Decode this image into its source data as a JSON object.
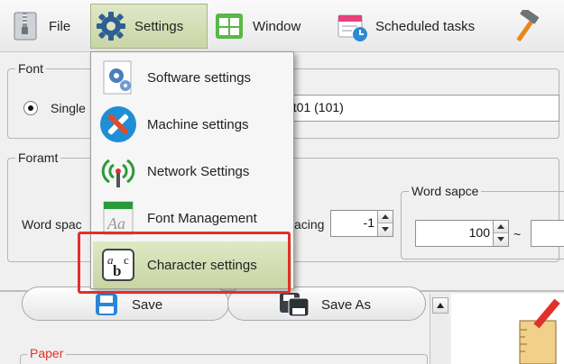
{
  "menubar": {
    "file_label": "File",
    "settings_label": "Settings",
    "window_label": "Window",
    "scheduled_label": "Scheduled tasks"
  },
  "font_group": {
    "title": "Font",
    "radio_label": "Single",
    "field_value": "nt01 (101)"
  },
  "format_group": {
    "title": "Foramt",
    "word_spacing_label": "Word spac",
    "spacing_label": "acing",
    "spacing_value": "-1"
  },
  "word_space_group": {
    "title": "Word sapce",
    "from_value": "100",
    "range_sep": "~"
  },
  "buttons": {
    "save_label": "Save",
    "save_as_label": "Save As"
  },
  "paper_group": {
    "title": "Paper",
    "title_color": "#e0302a"
  },
  "settings_menu": {
    "items": [
      {
        "label": "Software settings",
        "icon": "software-settings-icon"
      },
      {
        "label": "Machine settings",
        "icon": "machine-settings-icon"
      },
      {
        "label": "Network Settings",
        "icon": "network-settings-icon"
      },
      {
        "label": "Font Management",
        "icon": "font-management-icon"
      },
      {
        "label": "Character settings",
        "icon": "character-settings-icon"
      }
    ],
    "active_index": 4,
    "highlight_color": "#e0302a"
  }
}
